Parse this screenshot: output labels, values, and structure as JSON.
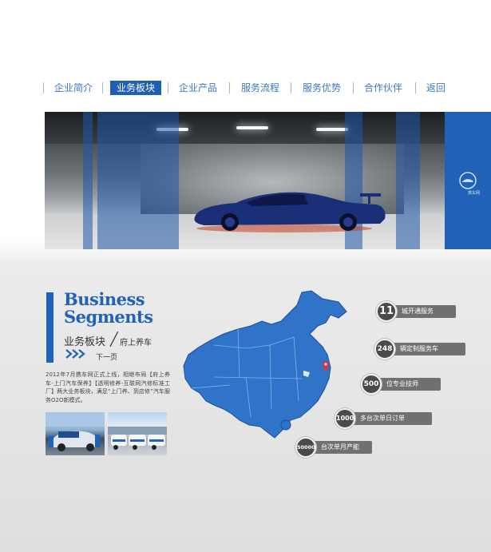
{
  "nav": {
    "items": [
      {
        "label": "企业简介",
        "active": false
      },
      {
        "label": "业务板块",
        "active": true
      },
      {
        "label": "企业产品",
        "active": false
      },
      {
        "label": "服务流程",
        "active": false
      },
      {
        "label": "服务优势",
        "active": false
      },
      {
        "label": "合作伙伴",
        "active": false
      },
      {
        "label": "返回",
        "active": false
      }
    ]
  },
  "banner": {
    "logo_icon": "car-brand-logo",
    "logo_text": "携车网"
  },
  "section": {
    "title_en_line1": "Business",
    "title_en_line2": "Segments",
    "title_cn": "业务板块",
    "slash": "╱",
    "subtitle": "府上养车",
    "arrows_icon": "double-chevron-right-icon",
    "next_label": "下一页",
    "description": "2012年7月携车网正式上线，相继布局【府上养车-上门汽车保养】【透明修养-互联网汽修标准工厂】两大业务板块，满足“上门养、到店修”汽车服务O2O新模式。"
  },
  "stats": [
    {
      "value": "11",
      "label": "城开通服务"
    },
    {
      "value": "248",
      "label": "辆定制服务车"
    },
    {
      "value": "500",
      "label": "位专业技师"
    },
    {
      "value": "1000",
      "label": "多台次单日订单"
    },
    {
      "value": "50000",
      "label": "台次单月产能"
    }
  ],
  "colors": {
    "brand_blue": "#1f62b7",
    "stat_circle": "#4a4a4a",
    "stat_pill": "#707070",
    "map_pin": "#e0303a"
  }
}
